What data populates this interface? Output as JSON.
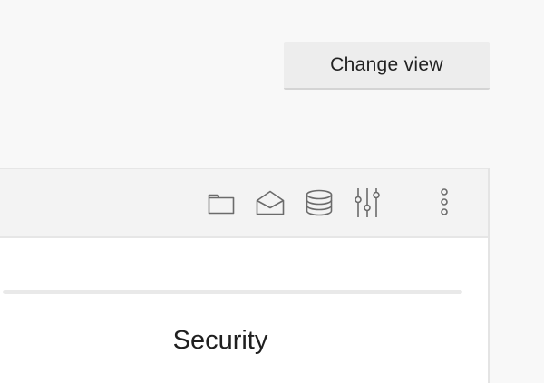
{
  "header": {
    "change_view_label": "Change view"
  },
  "toolbar": {
    "icons": [
      {
        "name": "folder-icon"
      },
      {
        "name": "mail-open-icon"
      },
      {
        "name": "database-icon"
      },
      {
        "name": "sliders-icon"
      },
      {
        "name": "more-vertical-icon"
      }
    ]
  },
  "content": {
    "progress_percent": 0,
    "section_title": "Security"
  },
  "colors": {
    "background": "#f8f8f8",
    "button_bg": "#ededed",
    "toolbar_bg": "#f3f3f3",
    "icon_stroke": "#6b6b6b",
    "text": "#1f1f1f"
  }
}
